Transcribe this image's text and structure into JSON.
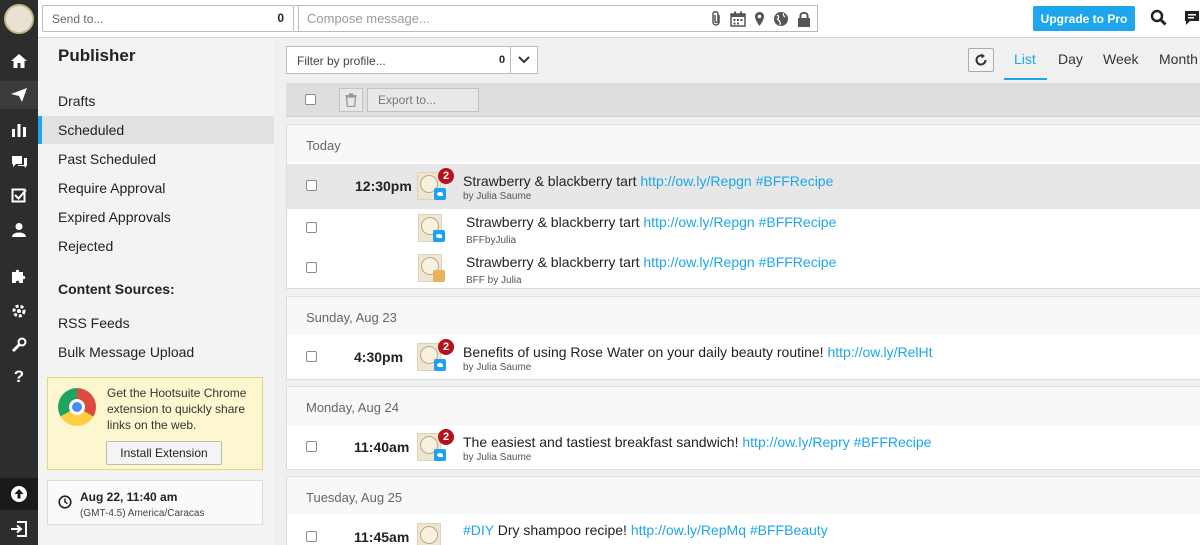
{
  "topbar": {
    "send_to_placeholder": "Send to...",
    "send_to_count": "0",
    "compose_placeholder": "Compose message...",
    "upgrade_label": "Upgrade to Pro"
  },
  "sidebar": {
    "title": "Publisher",
    "items": [
      {
        "label": "Drafts",
        "active": false
      },
      {
        "label": "Scheduled",
        "active": true
      },
      {
        "label": "Past Scheduled",
        "active": false
      },
      {
        "label": "Require Approval",
        "active": false
      },
      {
        "label": "Expired Approvals",
        "active": false
      },
      {
        "label": "Rejected",
        "active": false
      }
    ],
    "content_sources_heading": "Content Sources:",
    "content_sources": [
      {
        "label": "RSS Feeds"
      },
      {
        "label": "Bulk Message Upload"
      }
    ],
    "promo": {
      "text": "Get the Hootsuite Chrome extension to quickly share links on the web.",
      "button_label": "Install Extension"
    },
    "timezone": {
      "datetime": "Aug 22, 11:40 am",
      "zone": "(GMT-4.5) America/Caracas"
    }
  },
  "main": {
    "filter_placeholder": "Filter by profile...",
    "filter_count": "0",
    "view_tabs": [
      {
        "label": "List",
        "active": true
      },
      {
        "label": "Day",
        "active": false
      },
      {
        "label": "Week",
        "active": false
      },
      {
        "label": "Month",
        "active": false
      }
    ],
    "export_placeholder": "Export to...",
    "groups": [
      {
        "heading": "Today",
        "rows": [
          {
            "time": "12:30pm",
            "badge": "2",
            "text": "Strawberry & blackberry tart",
            "link": "http://ow.ly/Repgn #BFFRecipe",
            "by": "by Julia Saume",
            "network": "twitter"
          },
          {
            "time": "",
            "badge": "",
            "text": "Strawberry & blackberry tart",
            "link": "http://ow.ly/Repgn #BFFRecipe",
            "by": "BFFbyJulia",
            "network": "twitter"
          },
          {
            "time": "",
            "badge": "",
            "text": "Strawberry & blackberry tart",
            "link": "http://ow.ly/Repgn #BFFRecipe",
            "by": "BFF by Julia",
            "network": "facebook"
          }
        ]
      },
      {
        "heading": "Sunday, Aug 23",
        "rows": [
          {
            "time": "4:30pm",
            "badge": "2",
            "text": "Benefits of using Rose Water on your daily beauty routine!",
            "link": "http://ow.ly/RelHt",
            "by": "by Julia Saume",
            "network": "twitter"
          }
        ]
      },
      {
        "heading": "Monday, Aug 24",
        "rows": [
          {
            "time": "11:40am",
            "badge": "2",
            "text": "The easiest and tastiest breakfast sandwich!",
            "link": "http://ow.ly/Repry #BFFRecipe",
            "by": "by Julia Saume",
            "network": "twitter"
          }
        ]
      },
      {
        "heading": "Tuesday, Aug 25",
        "rows": [
          {
            "time": "11:45am",
            "badge": "",
            "hashtag": "#DIY",
            "text": "Dry shampoo recipe!",
            "link": "http://ow.ly/RepMq #BFFBeauty",
            "by": "",
            "network": ""
          }
        ]
      }
    ]
  },
  "colors": {
    "accent": "#1da6eb",
    "badge": "#b5121b",
    "rail": "#2d2d2d"
  }
}
